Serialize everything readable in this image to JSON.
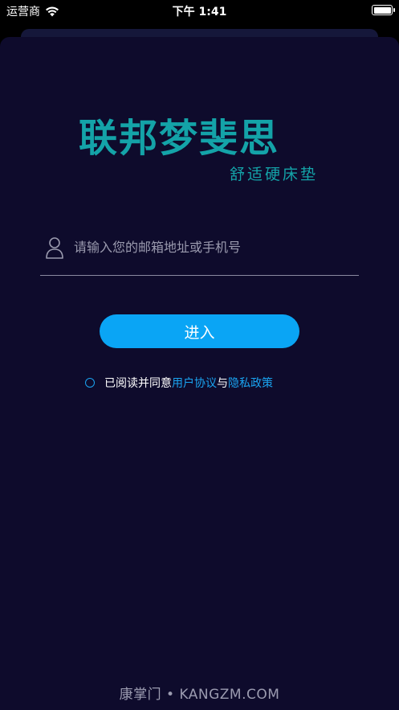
{
  "status_bar": {
    "carrier": "运营商",
    "time": "下午 1:41"
  },
  "logo": {
    "main": "联邦梦斐思",
    "sub": "舒适硬床垫",
    "color": "#14a3a8"
  },
  "login": {
    "account_placeholder": "请输入您的邮箱地址或手机号",
    "account_value": "",
    "enter_label": "进入"
  },
  "agreement": {
    "prefix": "已阅读并同意",
    "user_agreement": "用户协议",
    "conjunction": "与",
    "privacy_policy": "隐私政策"
  },
  "footer": {
    "watermark": "康掌门 • KANGZM.COM"
  },
  "colors": {
    "background": "#0e0b2c",
    "accent": "#0aa5f5",
    "link": "#1aa3f0"
  },
  "icons": {
    "signal": "wifi-icon",
    "battery": "battery-icon",
    "account": "user-icon",
    "agree": "radio-circle-icon"
  }
}
